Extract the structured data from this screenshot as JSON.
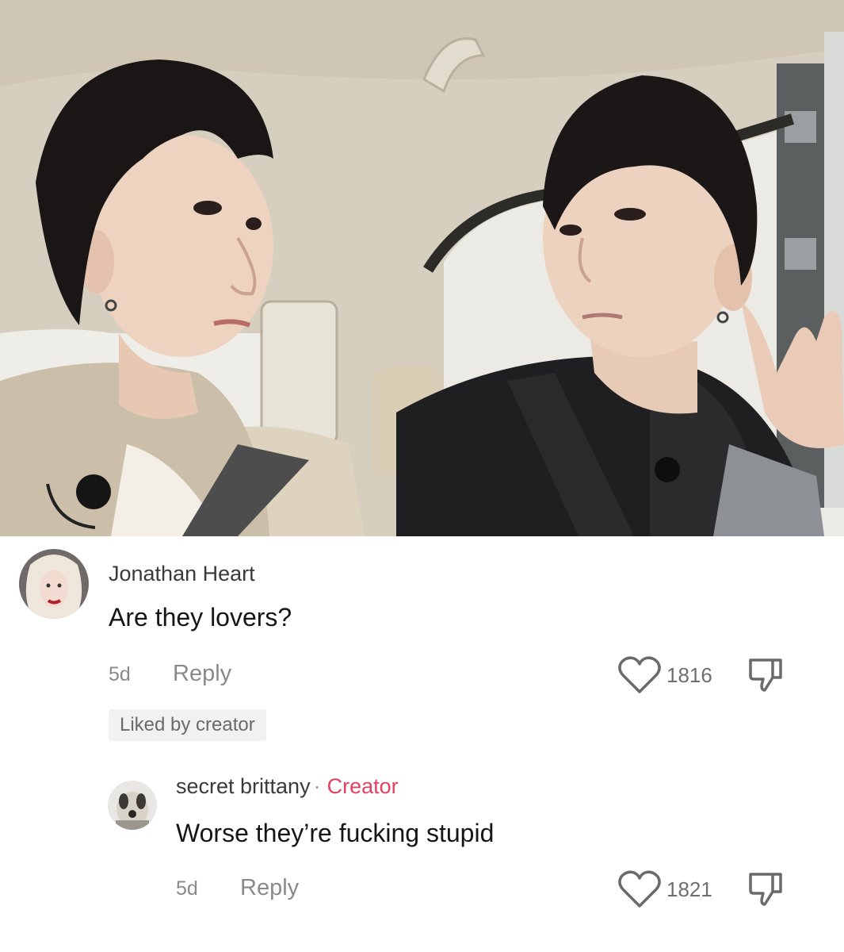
{
  "video": {
    "alt": "Two young men seated in the back of a car looking at each other"
  },
  "comments": [
    {
      "username": "Jonathan Heart",
      "text": "Are they lovers?",
      "time": "5d",
      "reply_label": "Reply",
      "likes": "1816",
      "liked_by_creator": "Liked by creator"
    },
    {
      "username": "secret brittany",
      "separator": "·",
      "badge": "Creator",
      "text": "Worse they’re fucking stupid",
      "time": "5d",
      "reply_label": "Reply",
      "likes": "1821"
    }
  ],
  "icons": {
    "like": "heart-outline-icon",
    "dislike": "thumbs-down-icon"
  },
  "colors": {
    "creator_badge": "#e2415f",
    "body_text": "#161616",
    "meta_text": "#8a8a8a"
  }
}
